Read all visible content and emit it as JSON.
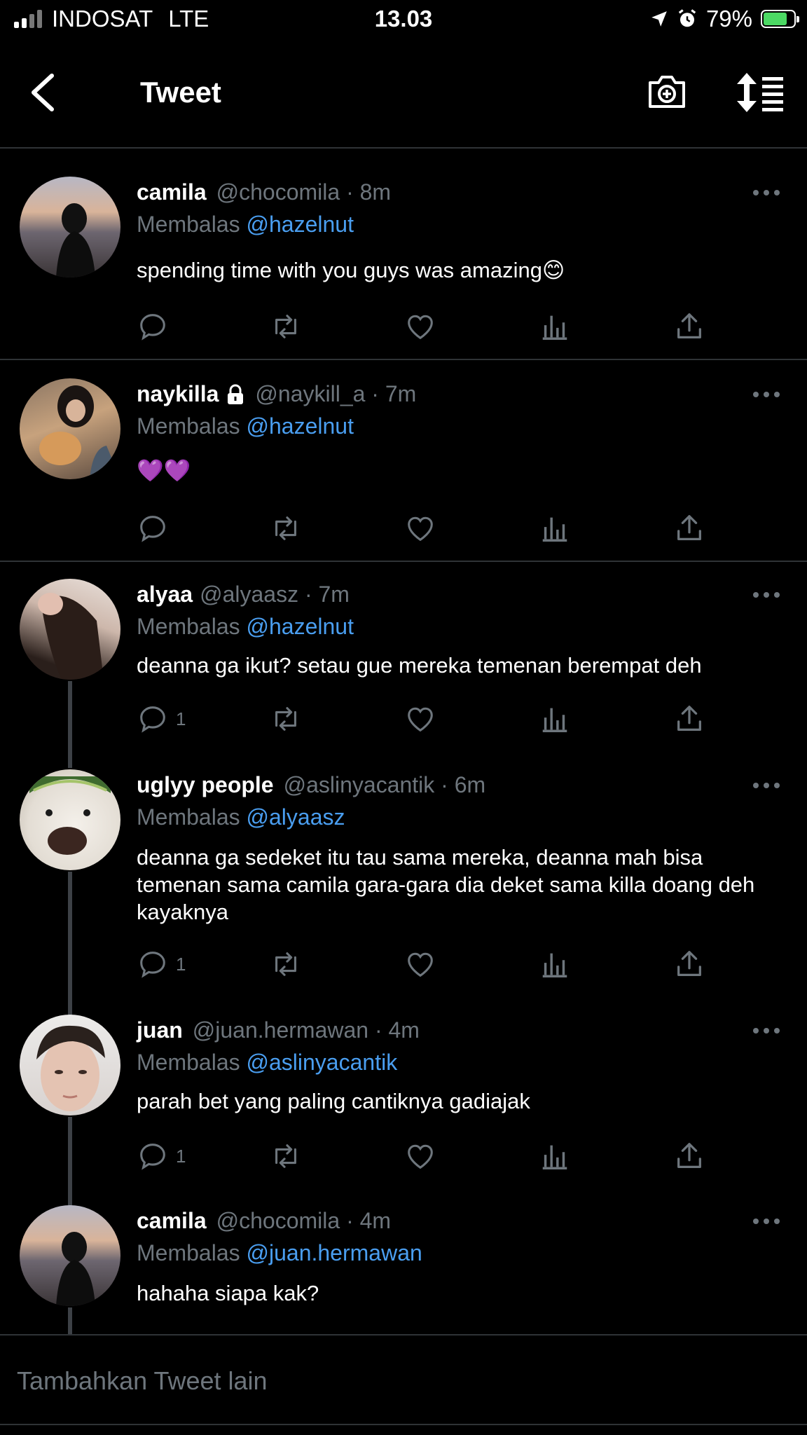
{
  "status_bar": {
    "carrier": "INDOSAT",
    "network": "LTE",
    "time": "13.03",
    "battery": "79%",
    "battery_level": 0.79
  },
  "header": {
    "title": "Tweet",
    "back_icon": "chevron-left-icon",
    "camera_icon": "camera-add-icon",
    "sort_icon": "sort-list-icon"
  },
  "reply_prefix": "Membalas",
  "tweets": [
    {
      "name": "camila",
      "handle": "@chocomila · 8m",
      "reply_to": "@hazelnut",
      "text": "spending time with you guys was amazing😊",
      "reply_count": "",
      "locked": false
    },
    {
      "name": "naykilla",
      "handle": "@naykill_a · 7m",
      "reply_to": "@hazelnut",
      "text": "💜💜",
      "reply_count": "",
      "locked": true
    },
    {
      "name": "alyaa",
      "handle": "@alyaasz · 7m",
      "reply_to": "@hazelnut",
      "text": "deanna ga ikut? setau gue mereka temenan berempat deh",
      "reply_count": "1",
      "locked": false
    },
    {
      "name": "uglyy people",
      "handle": "@aslinyacantik · 6m",
      "reply_to": "@alyaasz",
      "text": "deanna ga sedeket itu tau sama mereka, deanna mah bisa temenan sama camila gara-gara dia deket sama killa doang deh kayaknya",
      "reply_count": "1",
      "locked": false
    },
    {
      "name": "juan",
      "handle": "@juan.hermawan · 4m",
      "reply_to": "@aslinyacantik",
      "text": "parah bet yang paling cantiknya gadiajak",
      "reply_count": "1",
      "locked": false
    },
    {
      "name": "camila",
      "handle": "@chocomila · 4m",
      "reply_to": "@juan.hermawan",
      "text": "hahaha siapa kak?",
      "reply_count": "",
      "locked": false
    }
  ],
  "compose": {
    "placeholder": "Tambahkan Tweet lain"
  },
  "colors": {
    "background": "#000000",
    "mention": "#4a9ef0",
    "secondary_text": "#6e767d",
    "divider": "#2f3336"
  }
}
